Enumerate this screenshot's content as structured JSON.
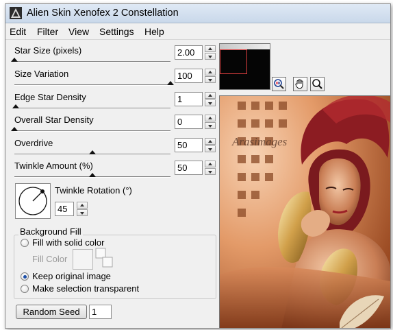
{
  "window": {
    "title": "Alien Skin Xenofex 2 Constellation"
  },
  "menu": [
    "Edit",
    "Filter",
    "View",
    "Settings",
    "Help"
  ],
  "sliders": [
    {
      "label": "Star Size (pixels)",
      "value": "2.00",
      "level": 0.0
    },
    {
      "label": "Size Variation",
      "value": "100",
      "level": 1.0
    },
    {
      "label": "Edge Star Density",
      "value": "1",
      "level": 0.01
    },
    {
      "label": "Overall Star Density",
      "value": "0",
      "level": 0.0
    },
    {
      "label": "Overdrive",
      "value": "50",
      "level": 0.5
    },
    {
      "label": "Twinkle Amount (%)",
      "value": "50",
      "level": 0.5
    }
  ],
  "rotation": {
    "label": "Twinkle Rotation (°)",
    "value": "45"
  },
  "background_fill": {
    "legend": "Background Fill",
    "options": [
      {
        "label": "Fill with solid color",
        "selected": false
      },
      {
        "label": "Keep original image",
        "selected": true
      },
      {
        "label": "Make selection transparent",
        "selected": false
      }
    ],
    "fill_color_label": "Fill Color"
  },
  "random_seed": {
    "button_label": "Random Seed",
    "value": "1"
  },
  "preview": {
    "watermark": "Arasimages"
  },
  "icons": {
    "app": "alien-skin-logo-icon",
    "zoom_fit": "zoom-fit-icon",
    "hand": "hand-pan-icon",
    "zoom": "magnifier-icon",
    "dial": "rotation-dial-icon"
  },
  "colors": {
    "accent_red": "#e04040",
    "preview_bg": "#d98a5a",
    "selected_radio": "#1c4fa8"
  }
}
